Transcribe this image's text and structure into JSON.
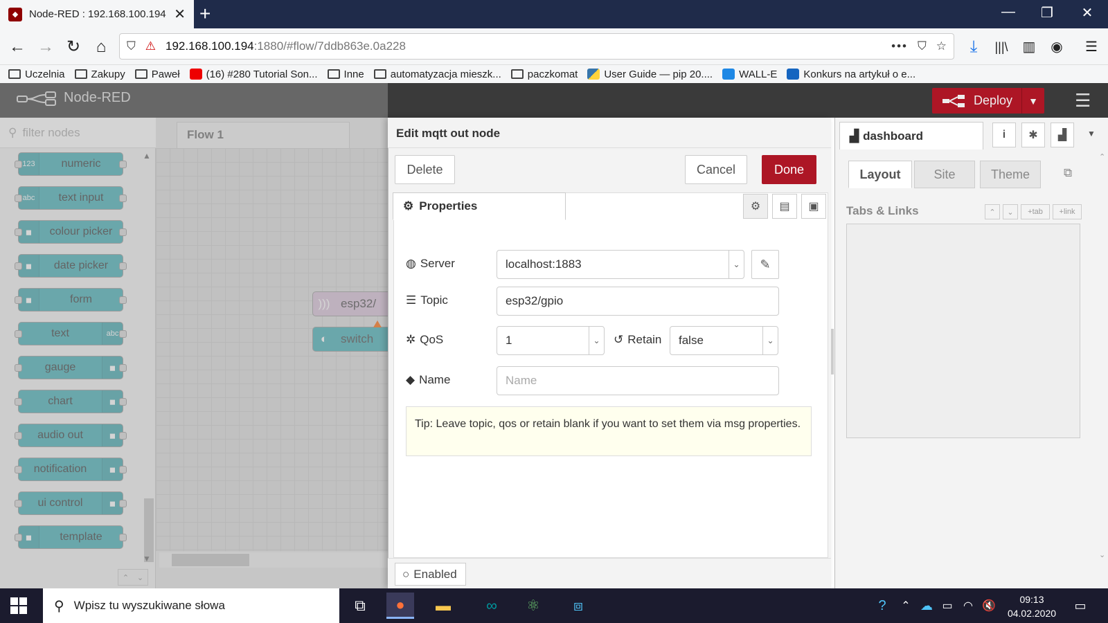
{
  "browser": {
    "tab_title": "Node-RED : 192.168.100.194",
    "url_host": "192.168.100.194",
    "url_path": ":1880/#flow/7ddb863e.0a228",
    "bookmarks": [
      "Uczelnia",
      "Zakupy",
      "Paweł",
      "(16) #280 Tutorial Son...",
      "Inne",
      "automatyzacja mieszk...",
      "paczkomat",
      "User Guide — pip 20....",
      "WALL-E",
      "Konkurs na artykuł o e..."
    ]
  },
  "header": {
    "app_name": "Node-RED",
    "deploy_label": "Deploy",
    "accent": "#ad1625"
  },
  "palette": {
    "filter_placeholder": "filter nodes",
    "nodes": [
      {
        "label": "numeric",
        "icon": "123"
      },
      {
        "label": "text input",
        "icon": "abc"
      },
      {
        "label": "colour picker",
        "icon": "palette-icon"
      },
      {
        "label": "date picker",
        "icon": "calendar-icon"
      },
      {
        "label": "form",
        "icon": "form-icon"
      },
      {
        "label": "text",
        "icon": "abc"
      },
      {
        "label": "gauge",
        "icon": "gauge-icon"
      },
      {
        "label": "chart",
        "icon": "chart-icon"
      },
      {
        "label": "audio out",
        "icon": "audio-icon"
      },
      {
        "label": "notification",
        "icon": "envelope-icon"
      },
      {
        "label": "ui control",
        "icon": "control-icon"
      },
      {
        "label": "template",
        "icon": "code-icon"
      }
    ]
  },
  "workspace": {
    "flow_tab": "Flow 1",
    "nodes": [
      "esp32/",
      "switch"
    ]
  },
  "editor": {
    "title": "Edit mqtt out node",
    "delete_label": "Delete",
    "cancel_label": "Cancel",
    "done_label": "Done",
    "properties_tab": "Properties",
    "server_label": "Server",
    "server_value": "localhost:1883",
    "topic_label": "Topic",
    "topic_value": "esp32/gpio",
    "qos_label": "QoS",
    "qos_value": "1",
    "retain_label": "Retain",
    "retain_value": "false",
    "name_label": "Name",
    "name_placeholder": "Name",
    "tip": "Tip: Leave topic, qos or retain blank if you want to set them via msg properties.",
    "enabled_label": "Enabled"
  },
  "sidebar": {
    "tab_label": "dashboard",
    "subtabs": [
      "Layout",
      "Site",
      "Theme"
    ],
    "section_title": "Tabs & Links",
    "tab_btn": "tab",
    "link_btn": "link"
  },
  "taskbar": {
    "search_placeholder": "Wpisz tu wyszukiwane słowa",
    "time": "09:13",
    "date": "04.02.2020"
  }
}
